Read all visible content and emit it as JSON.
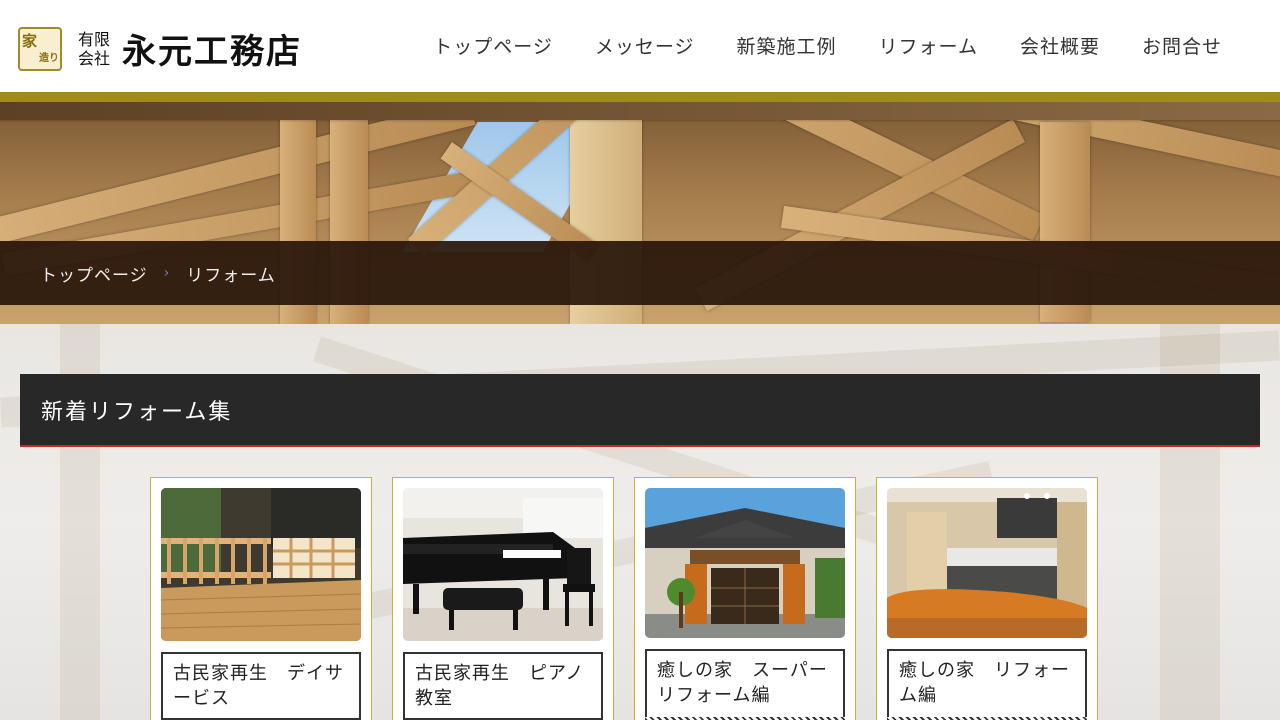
{
  "logo": {
    "seal_top": "家",
    "seal_bottom": "造り",
    "small_line1": "有限",
    "small_line2": "会社",
    "name": "永元工務店"
  },
  "nav": [
    "トップページ",
    "メッセージ",
    "新築施工例",
    "リフォーム",
    "会社概要",
    "お問合せ"
  ],
  "colors": {
    "accent_gold": "#a08b1e",
    "title_underline": "#c12a2a",
    "breadcrumb_bg": "#2c1a0c"
  },
  "breadcrumb": {
    "home": "トップページ",
    "separator": "›",
    "current": "リフォーム"
  },
  "section": {
    "title": "新着リフォーム集"
  },
  "cards": [
    {
      "title": "古民家再生　デイサービス",
      "image": "veranda-wooden-railing-photo"
    },
    {
      "title": "古民家再生　ピアノ教室",
      "image": "grand-piano-room-photo"
    },
    {
      "title": "癒しの家　スーパーリフォーム編",
      "image": "traditional-house-exterior-photo"
    },
    {
      "title": "癒しの家　リフォーム編",
      "image": "wooden-kitchen-dining-photo"
    }
  ]
}
